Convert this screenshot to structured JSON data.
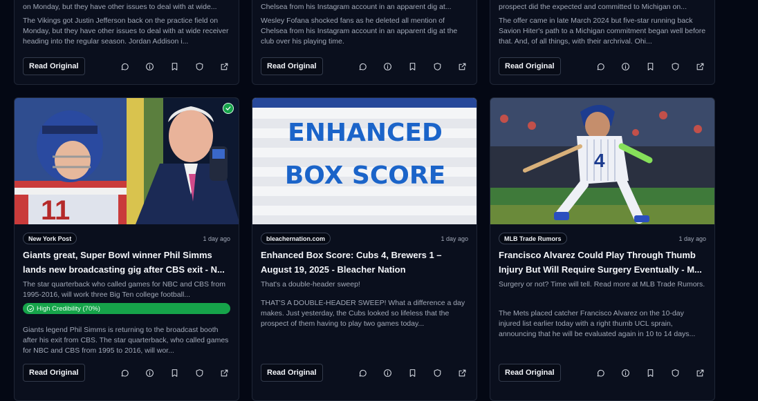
{
  "cards_top": [
    {
      "snippet_head": "on Monday, but they have other issues to deal with at wide...",
      "snippet": "The Vikings got Justin Jefferson back on the practice field on Monday, but they have other issues to deal with at wide receiver heading into the regular season. Jordan Addison i...",
      "read_label": "Read Original"
    },
    {
      "snippet_head": "Chelsea from his Instagram account in an apparent dig at...",
      "snippet": "Wesley Fofana shocked fans as he deleted all mention of Chelsea from his Instagram account in an apparent dig at the club over his playing time.",
      "read_label": "Read Original"
    },
    {
      "snippet_head": "prospect did the expected and committed to Michigan on...",
      "snippet": "The offer came in late March 2024 but five-star running back Savion Hiter's path to a Michigan commitment began well before that. And, of all things, with their archrival. Ohi...",
      "read_label": "Read Original"
    }
  ],
  "cards_bottom": [
    {
      "source": "New York Post",
      "time": "1 day ago",
      "title": "Giants great, Super Bowl winner Phil Simms lands new broadcasting gig after CBS exit - N...",
      "summary": "The star quarterback who called games for NBC and CBS from 1995-2016, will work three Big Ten college football...",
      "credibility": "High Credibility (70%)",
      "snippet": "Giants legend Phil Simms is returning to the broadcast booth after his exit from CBS. The star quarterback, who called games for NBC and CBS from 1995 to 2016, will wor...",
      "read_label": "Read Original",
      "jersey_number": "11"
    },
    {
      "source": "bleachernation.com",
      "time": "1 day ago",
      "title": "Enhanced Box Score: Cubs 4, Brewers 1 – August 19, 2025 - Bleacher Nation",
      "summary": "That's a double-header sweep!",
      "snippet": "THAT'S A DOUBLE-HEADER SWEEP! What a difference a day makes. Just yesterday, the Cubs looked so lifeless that the prospect of them having to play two games today...",
      "read_label": "Read Original",
      "image_text_1": "ENHANCED",
      "image_text_2": "BOX SCORE"
    },
    {
      "source": "MLB Trade Rumors",
      "time": "1 day ago",
      "title": "Francisco Alvarez Could Play Through Thumb Injury But Will Require Surgery Eventually - M...",
      "summary": "Surgery or not? Time will tell. Read more at MLB Trade Rumors.",
      "snippet": "The Mets placed catcher Francisco Alvarez on the 10-day injured list earlier today with a right thumb UCL sprain, announcing that he will be evaluated again in 10 to 14 days...",
      "read_label": "Read Original",
      "jersey_number": "4"
    }
  ],
  "action_icons": [
    "comment-icon",
    "info-icon",
    "bookmark-icon",
    "shield-icon",
    "external-link-icon"
  ],
  "colors": {
    "background": "#040814",
    "card": "#0a0f1d",
    "credibility": "#16a34a",
    "box_score_text": "#1b64c9"
  }
}
